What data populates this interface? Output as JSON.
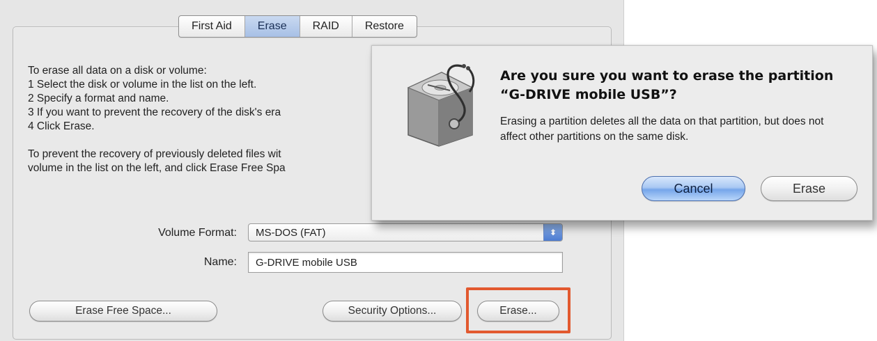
{
  "tabs": [
    {
      "label": "First Aid",
      "active": false
    },
    {
      "label": "Erase",
      "active": true
    },
    {
      "label": "RAID",
      "active": false
    },
    {
      "label": "Restore",
      "active": false
    }
  ],
  "instructions": {
    "heading": "To erase all data on a disk or volume:",
    "steps": [
      "1 Select the disk or volume in the list on the left.",
      "2 Specify a format and name.",
      "3 If you want to prevent the recovery of the disk's era",
      "4 Click Erase."
    ],
    "free_space_line1": "To prevent the recovery of previously deleted files wit",
    "free_space_line2": "volume in the list on the left, and click Erase Free Spa"
  },
  "form": {
    "volume_format_label": "Volume Format:",
    "volume_format_value": "MS-DOS (FAT)",
    "name_label": "Name:",
    "name_value": "G-DRIVE mobile USB"
  },
  "buttons": {
    "erase_free_space": "Erase Free Space...",
    "security_options": "Security Options...",
    "erase": "Erase..."
  },
  "alert": {
    "icon": "disk-utility-icon",
    "title": "Are you sure you want to erase the partition “G-DRIVE mobile USB”?",
    "body": "Erasing a partition deletes all the data on that partition, but does not affect other partitions on the same disk.",
    "cancel_label": "Cancel",
    "erase_label": "Erase"
  },
  "colors": {
    "highlight": "#e2592f",
    "default_button": "#76a6ea",
    "selected_tab": "#a7c0e6"
  }
}
